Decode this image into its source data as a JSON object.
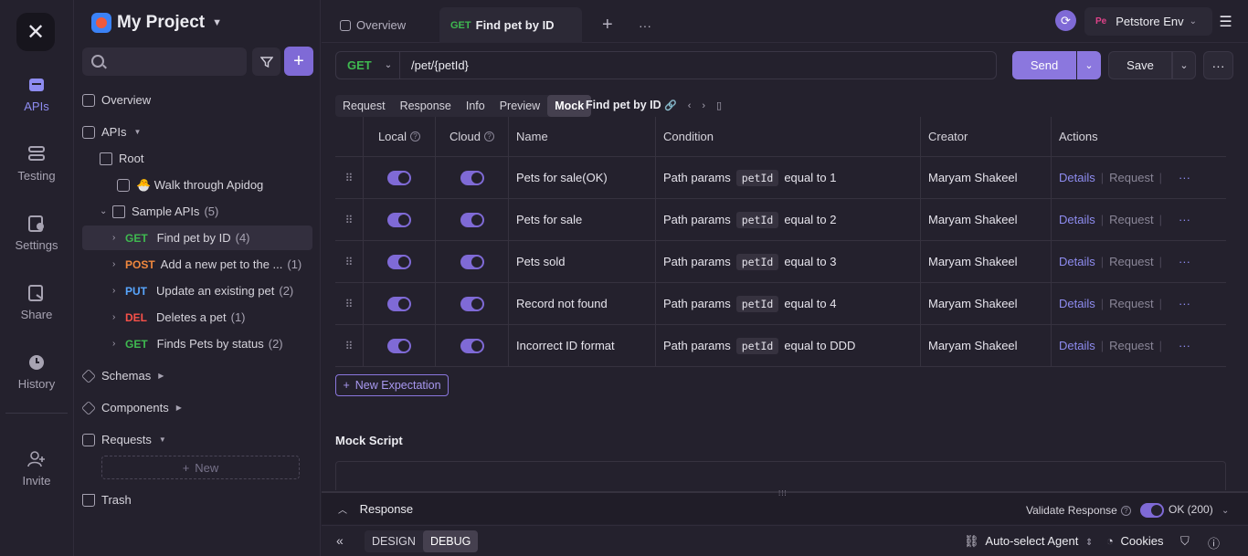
{
  "rail": {
    "items": [
      {
        "label": "APIs"
      },
      {
        "label": "Testing"
      },
      {
        "label": "Settings"
      },
      {
        "label": "Share"
      },
      {
        "label": "History"
      },
      {
        "label": "Invite"
      }
    ]
  },
  "sidebar": {
    "project_name": "My Project",
    "search_placeholder": "",
    "overview": "Overview",
    "apis": "APIs",
    "root": "Root",
    "walkthrough": "🐣 Walk through Apidog",
    "sample_apis": "Sample APIs",
    "sample_count": "(5)",
    "endpoints": [
      {
        "method": "GET",
        "name": "Find pet by ID",
        "count": "(4)"
      },
      {
        "method": "POST",
        "name": "Add a new pet to the ...",
        "count": "(1)"
      },
      {
        "method": "PUT",
        "name": "Update an existing pet",
        "count": "(2)"
      },
      {
        "method": "DEL",
        "name": "Deletes a pet",
        "count": "(1)"
      },
      {
        "method": "GET",
        "name": "Finds Pets by status",
        "count": "(2)"
      }
    ],
    "schemas": "Schemas",
    "components": "Components",
    "requests": "Requests",
    "new": "New",
    "trash": "Trash"
  },
  "tabs": {
    "overview": "Overview",
    "active_method": "GET",
    "active_label": "Find pet by ID"
  },
  "env": {
    "badge": "Pe",
    "name": "Petstore Env"
  },
  "request": {
    "method": "GET",
    "path": "/pet/{petId}",
    "send": "Send",
    "save": "Save"
  },
  "subtabs": {
    "items": [
      "Request",
      "Response",
      "Info",
      "Preview",
      "Mock"
    ],
    "active": "Mock",
    "title": "Find pet by ID"
  },
  "mock_table": {
    "headers": [
      "Local",
      "Cloud",
      "Name",
      "Condition",
      "Creator",
      "Actions"
    ],
    "condition_prefix": "Path params",
    "param": "petId",
    "equal_text": "equal to",
    "details": "Details",
    "request": "Request",
    "rows": [
      {
        "name": "Pets for sale(OK)",
        "value": "1",
        "creator": "Maryam Shakeel"
      },
      {
        "name": "Pets for sale",
        "value": "2",
        "creator": "Maryam Shakeel"
      },
      {
        "name": "Pets sold",
        "value": "3",
        "creator": "Maryam Shakeel"
      },
      {
        "name": "Record not found",
        "value": "4",
        "creator": "Maryam Shakeel"
      },
      {
        "name": "Incorrect ID format",
        "value": "DDD",
        "creator": "Maryam Shakeel"
      }
    ]
  },
  "new_expectation": "New Expectation",
  "mock_script": "Mock Script",
  "response": {
    "title": "Response",
    "validate": "Validate Response",
    "status": "OK (200)"
  },
  "bottom": {
    "design": "DESIGN",
    "debug": "DEBUG",
    "agent": "Auto-select Agent",
    "cookies": "Cookies"
  }
}
